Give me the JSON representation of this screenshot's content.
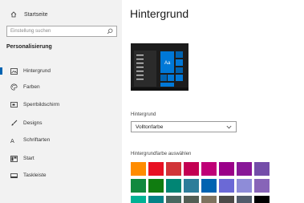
{
  "sidebar": {
    "home_label": "Startseite",
    "search_placeholder": "Einstellung suchen",
    "section_title": "Personalisierung",
    "items": [
      {
        "label": "Hintergrund",
        "icon": "picture-icon",
        "active": true
      },
      {
        "label": "Farben",
        "icon": "palette-icon",
        "active": false
      },
      {
        "label": "Sperrbildschirm",
        "icon": "lock-screen-icon",
        "active": false
      },
      {
        "label": "Designs",
        "icon": "brush-icon",
        "active": false
      },
      {
        "label": "Schriftarten",
        "icon": "font-icon",
        "active": false
      },
      {
        "label": "Start",
        "icon": "start-icon",
        "active": false
      },
      {
        "label": "Taskleiste",
        "icon": "taskbar-icon",
        "active": false
      }
    ]
  },
  "main": {
    "title": "Hintergrund",
    "preview": {
      "sample_text": "Aa",
      "accent": "#0078d7"
    },
    "background_label": "Hintergrund",
    "background_value": "Volltonfarbe",
    "color_label": "Hintergrundfarbe auswählen"
  },
  "swatches": [
    [
      "#ff8c00",
      "#e81123",
      "#d13438",
      "#c30052",
      "#bf0077",
      "#9a0089",
      "#881798",
      "#744da9"
    ],
    [
      "#10893e",
      "#107c10",
      "#018574",
      "#2d7d9a",
      "#0063b1",
      "#6b69d6",
      "#8e8cd8",
      "#8764b8"
    ],
    [
      "#00b294",
      "#038387",
      "#486860",
      "#525e54",
      "#7e735f",
      "#4c4a48",
      "#515c6b",
      "#000000"
    ]
  ]
}
